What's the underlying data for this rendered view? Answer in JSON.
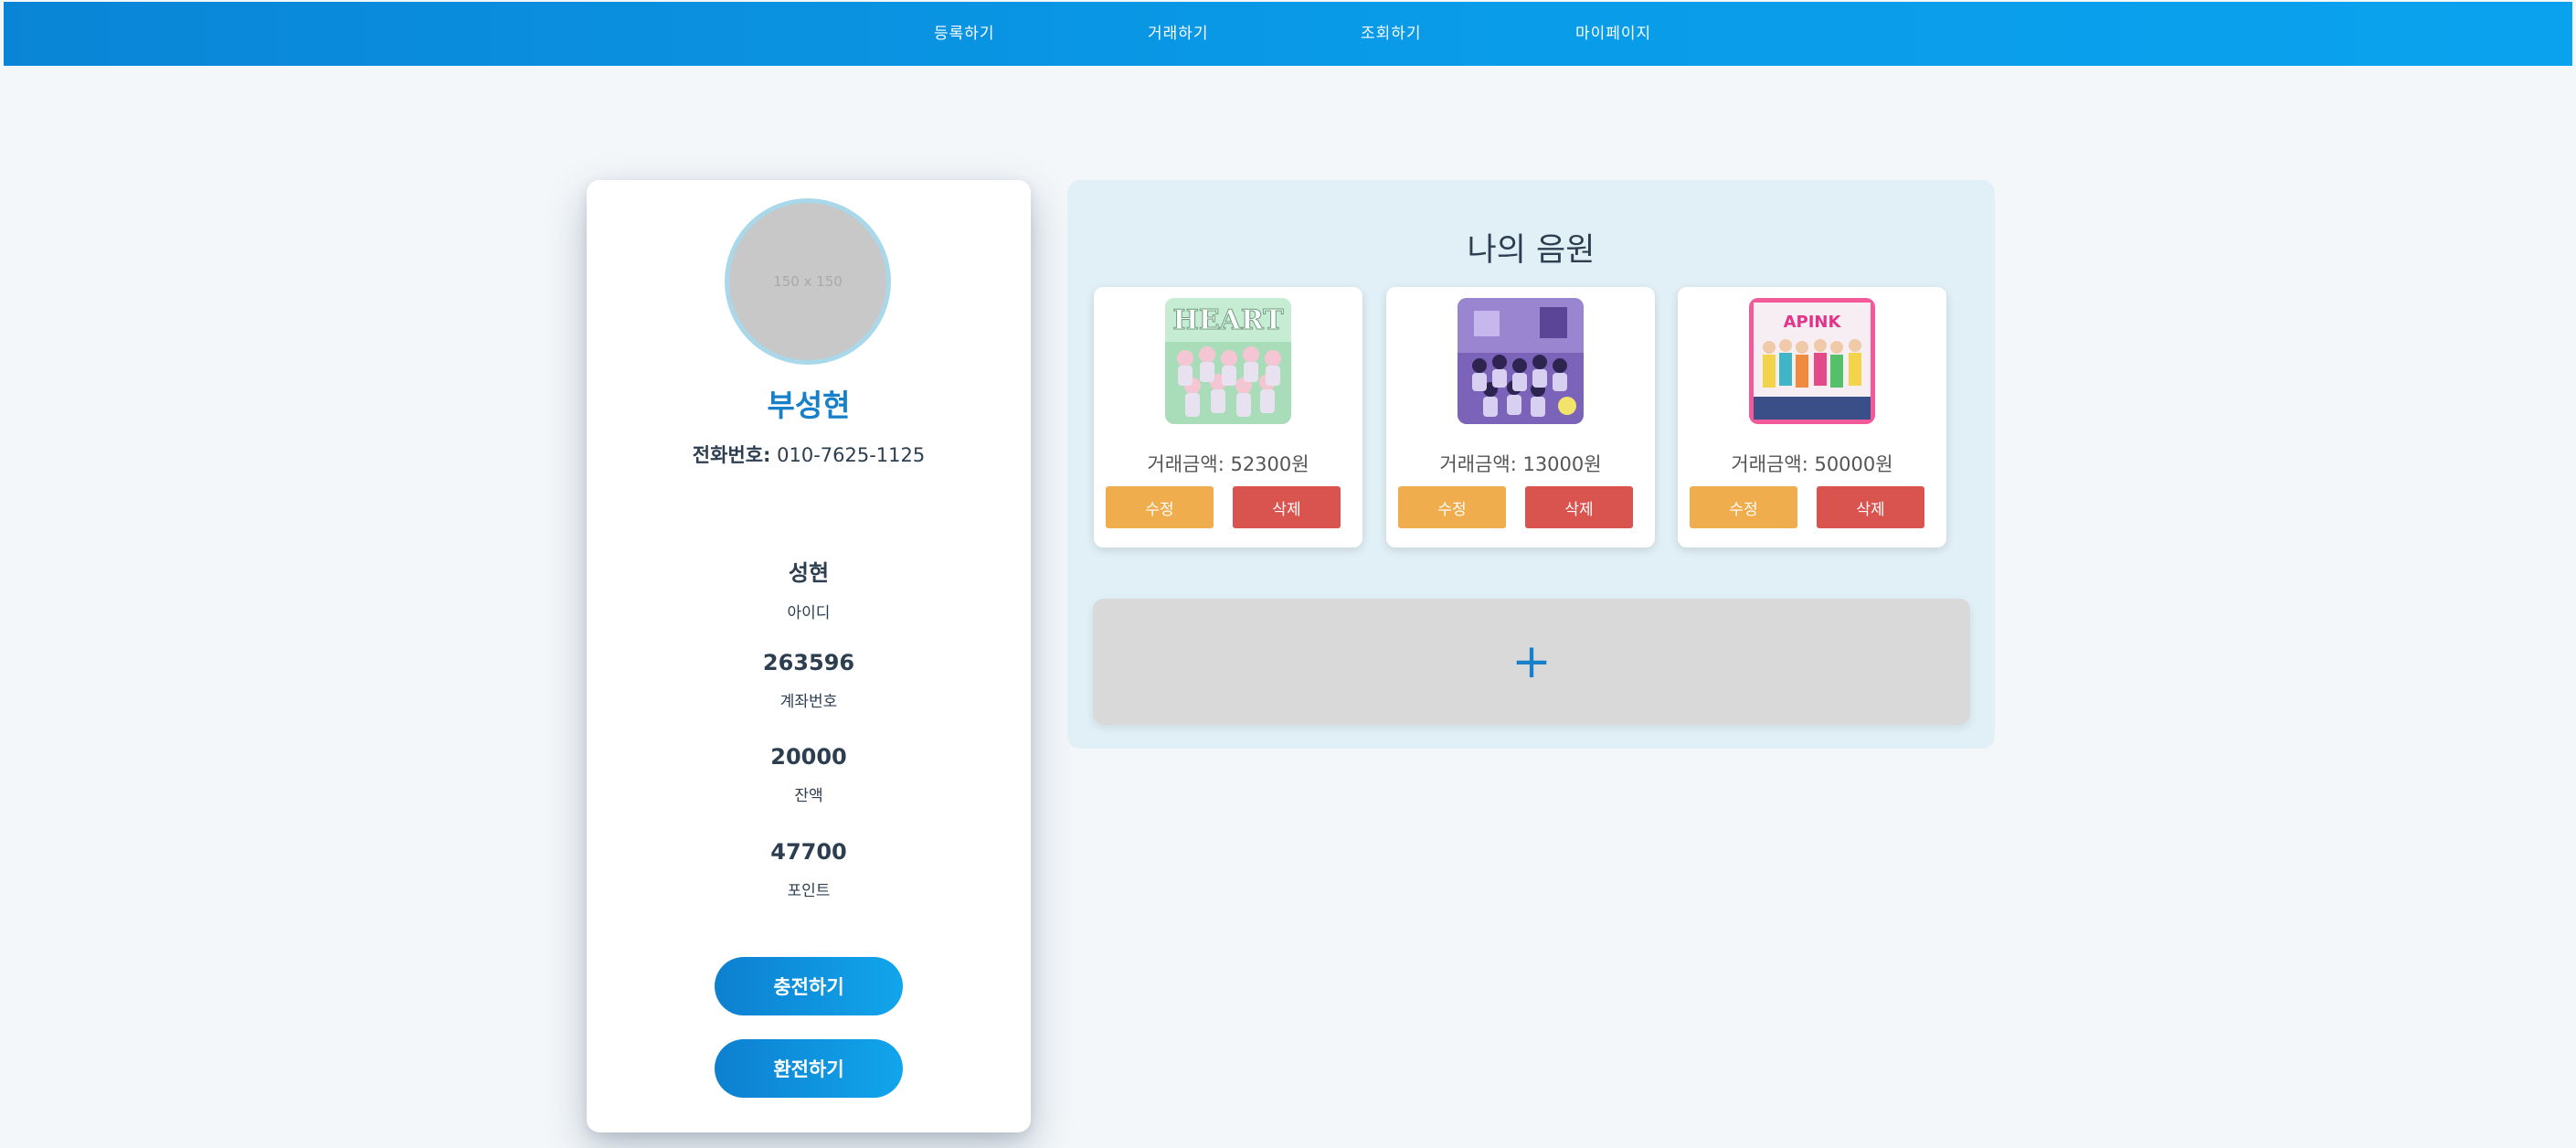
{
  "nav": {
    "items": [
      "등록하기",
      "거래하기",
      "조회하기",
      "마이페이지"
    ]
  },
  "profile": {
    "avatar_placeholder": "150 x 150",
    "name": "부성현",
    "phone_label": "전화번호:",
    "phone": "010-7625-1125",
    "stats": [
      {
        "value": "성현",
        "caption": "아이디"
      },
      {
        "value": "263596",
        "caption": "계좌번호"
      },
      {
        "value": "20000",
        "caption": "잔액"
      },
      {
        "value": "47700",
        "caption": "포인트"
      }
    ],
    "charge_label": "충전하기",
    "exchange_label": "환전하기"
  },
  "music": {
    "title": "나의 음원",
    "cards": [
      {
        "price": "거래금액: 52300원",
        "edit_label": "수정",
        "delete_label": "삭제"
      },
      {
        "price": "거래금액: 13000원",
        "edit_label": "수정",
        "delete_label": "삭제"
      },
      {
        "price": "거래금액: 50000원",
        "edit_label": "수정",
        "delete_label": "삭제"
      }
    ],
    "add_symbol": "+"
  },
  "colors": {
    "nav_bg": "#0a85d6",
    "accent": "#1780c8",
    "edit_button": "#f0ad4e",
    "delete_button": "#d9534f",
    "panel_bg": "#e0f0f6"
  }
}
